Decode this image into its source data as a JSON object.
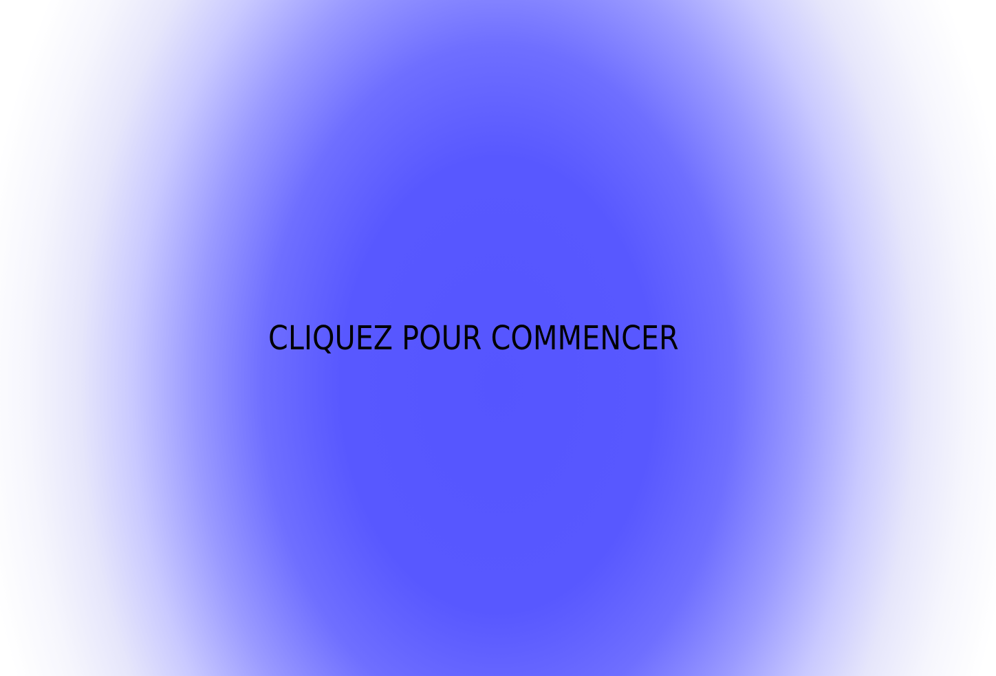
{
  "start_screen": {
    "prompt_text": "CLIQUEZ POUR COMMENCER"
  },
  "colors": {
    "background": "#ffffff",
    "glow_center": "#5555ff",
    "text": "#000000"
  }
}
